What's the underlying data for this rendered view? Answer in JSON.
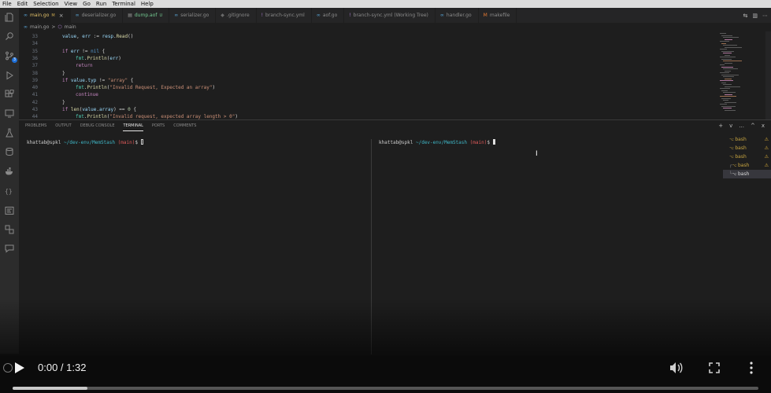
{
  "menu": [
    "File",
    "Edit",
    "Selection",
    "View",
    "Go",
    "Run",
    "Terminal",
    "Help"
  ],
  "tabs": [
    {
      "label": "main.go",
      "status": "M",
      "active": true,
      "icon": "go-icon"
    },
    {
      "label": "deserializer.go",
      "status": "",
      "active": false,
      "icon": "go-icon"
    },
    {
      "label": "dump.aof",
      "status": "U",
      "active": false,
      "icon": "file-icon"
    },
    {
      "label": "serializer.go",
      "status": "",
      "active": false,
      "icon": "go-icon"
    },
    {
      "label": ".gitignore",
      "status": "",
      "active": false,
      "icon": "git-icon"
    },
    {
      "label": "branch-sync.yml",
      "status": "",
      "active": false,
      "icon": "yaml-icon"
    },
    {
      "label": "aof.go",
      "status": "",
      "active": false,
      "icon": "go-icon"
    },
    {
      "label": "branch-sync.yml (Working Tree)",
      "status": "",
      "active": false,
      "icon": "yaml-icon"
    },
    {
      "label": "handler.go",
      "status": "",
      "active": false,
      "icon": "go-icon"
    },
    {
      "label": "makefile",
      "status": "",
      "active": false,
      "icon": "makefile-icon"
    }
  ],
  "breadcrumb": {
    "file": "main.go",
    "separator": ">",
    "symbol": "main"
  },
  "editor": {
    "lines": [
      {
        "num": "33",
        "indent": 1,
        "tokens": [
          [
            "var",
            "value"
          ],
          [
            "p",
            ", "
          ],
          [
            "var",
            "err"
          ],
          [
            "p",
            " := "
          ],
          [
            "var",
            "resp"
          ],
          [
            "p",
            "."
          ],
          [
            "fn",
            "Read"
          ],
          [
            "p",
            "()"
          ]
        ]
      },
      {
        "num": "34",
        "indent": 0,
        "tokens": []
      },
      {
        "num": "35",
        "indent": 1,
        "tokens": [
          [
            "kw",
            "if "
          ],
          [
            "var",
            "err"
          ],
          [
            "p",
            " != "
          ],
          [
            "kw2",
            "nil"
          ],
          [
            "p",
            " {"
          ]
        ]
      },
      {
        "num": "36",
        "indent": 2,
        "tokens": [
          [
            "ty",
            "fmt"
          ],
          [
            "p",
            "."
          ],
          [
            "fn",
            "Println"
          ],
          [
            "p",
            "("
          ],
          [
            "var",
            "err"
          ],
          [
            "p",
            ")"
          ]
        ]
      },
      {
        "num": "37",
        "indent": 2,
        "tokens": [
          [
            "kw",
            "return"
          ]
        ]
      },
      {
        "num": "38",
        "indent": 1,
        "tokens": [
          [
            "p",
            "}"
          ]
        ]
      },
      {
        "num": "39",
        "indent": 1,
        "tokens": [
          [
            "kw",
            "if "
          ],
          [
            "var",
            "value"
          ],
          [
            "p",
            "."
          ],
          [
            "var",
            "typ"
          ],
          [
            "p",
            " != "
          ],
          [
            "str",
            "\"array\""
          ],
          [
            "p",
            " {"
          ]
        ]
      },
      {
        "num": "40",
        "indent": 2,
        "tokens": [
          [
            "ty",
            "fmt"
          ],
          [
            "p",
            "."
          ],
          [
            "fn",
            "Println"
          ],
          [
            "p",
            "("
          ],
          [
            "str",
            "\"Invalid Request, Expected an array\""
          ],
          [
            "p",
            ")"
          ]
        ]
      },
      {
        "num": "41",
        "indent": 2,
        "tokens": [
          [
            "kw",
            "continue"
          ]
        ]
      },
      {
        "num": "42",
        "indent": 1,
        "tokens": [
          [
            "p",
            "}"
          ]
        ]
      },
      {
        "num": "43",
        "indent": 1,
        "tokens": [
          [
            "kw",
            "if "
          ],
          [
            "fn",
            "len"
          ],
          [
            "p",
            "("
          ],
          [
            "var",
            "value"
          ],
          [
            "p",
            "."
          ],
          [
            "var",
            "array"
          ],
          [
            "p",
            ") == "
          ],
          [
            "num",
            "0"
          ],
          [
            "p",
            " {"
          ]
        ]
      },
      {
        "num": "44",
        "indent": 2,
        "tokens": [
          [
            "ty",
            "fmt"
          ],
          [
            "p",
            "."
          ],
          [
            "fn",
            "Println"
          ],
          [
            "p",
            "("
          ],
          [
            "str",
            "\"Invalid request, expected array length > 0\""
          ],
          [
            "p",
            ")"
          ]
        ]
      }
    ]
  },
  "panel": {
    "tabs": [
      "PROBLEMS",
      "OUTPUT",
      "DEBUG CONSOLE",
      "TERMINAL",
      "PORTS",
      "COMMENTS"
    ],
    "active_tab": "TERMINAL",
    "tools": [
      "+",
      "v",
      "...",
      "^",
      "x"
    ]
  },
  "terminal": {
    "user": "khattab@spkl",
    "path": "~/dev-env/MemStash",
    "branch": "(main)",
    "prompt": "$"
  },
  "terminal_list": [
    {
      "label": "bash",
      "warn": true,
      "active": false,
      "tree": ""
    },
    {
      "label": "bash",
      "warn": true,
      "active": false,
      "tree": ""
    },
    {
      "label": "bash",
      "warn": true,
      "active": false,
      "tree": ""
    },
    {
      "label": "bash",
      "warn": true,
      "active": false,
      "tree": "┌"
    },
    {
      "label": "bash",
      "warn": false,
      "active": true,
      "tree": "└"
    }
  ],
  "video": {
    "current_time": "0:00",
    "separator": "/",
    "duration": "1:32",
    "time_display": "0:00 / 1:32",
    "progress": 0.1
  },
  "colors": {
    "accent": "#1e6fd8",
    "terminal_path": "#3fb7c7",
    "terminal_branch": "#e05a5a",
    "warn": "#e0b13a"
  }
}
